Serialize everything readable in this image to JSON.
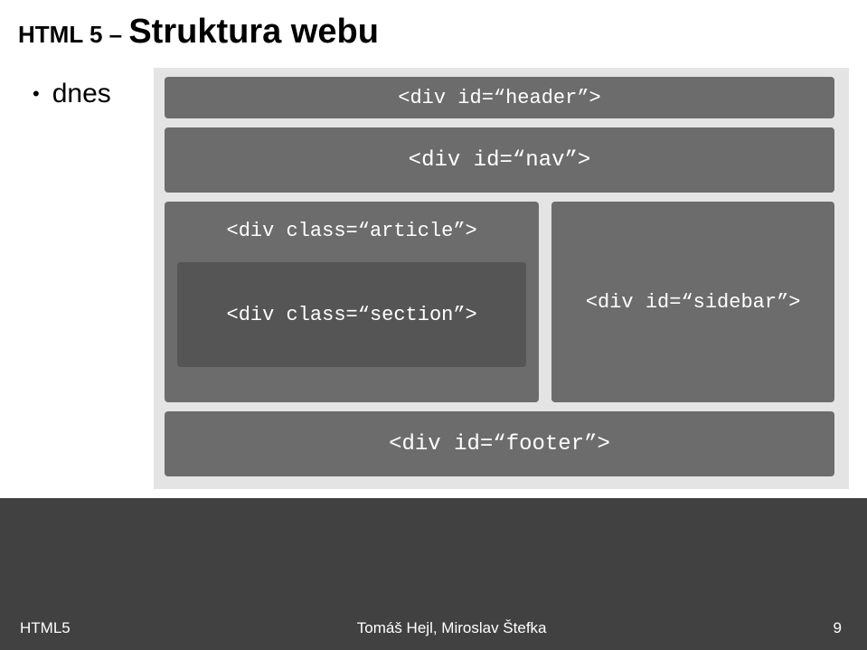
{
  "title": {
    "prefix": "HTML 5 – ",
    "main": "Struktura webu"
  },
  "bullet": "dnes",
  "diagram": {
    "header": "<div id=“header”>",
    "nav": "<div id=“nav”>",
    "article": "<div class=“article”>",
    "section": "<div class=“section”>",
    "sidebar": "<div id=“sidebar”>",
    "footer": "<div id=“footer”>"
  },
  "footer": {
    "left": "HTML5",
    "center": "Tomáš Hejl, Miroslav Štefka",
    "right": "9"
  }
}
